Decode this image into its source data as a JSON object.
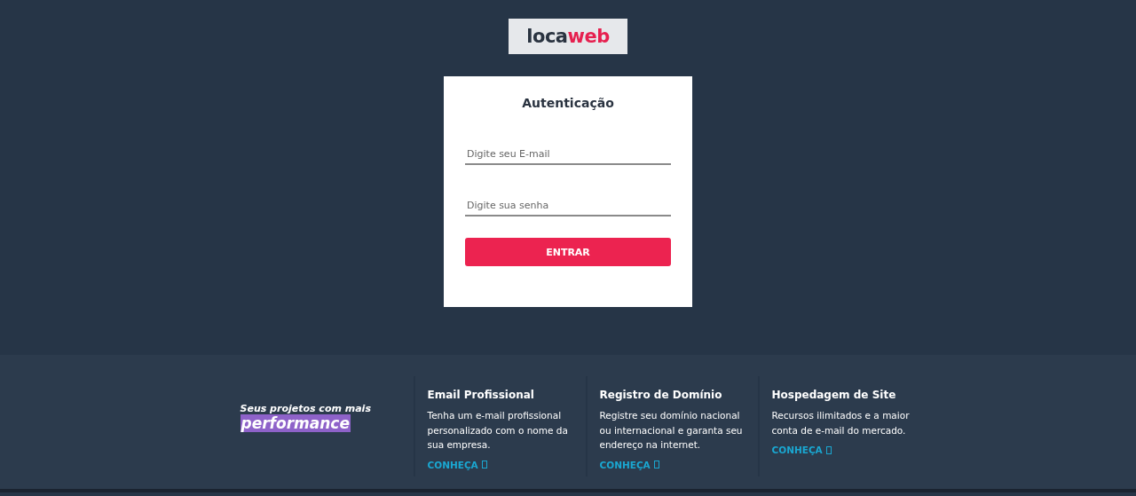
{
  "logo": {
    "text_dark": "loca",
    "text_accent": "web"
  },
  "login": {
    "title": "Autenticação",
    "email": {
      "placeholder": "Digite seu E-mail"
    },
    "password": {
      "placeholder": "Digite sua senha"
    },
    "submit": "ENTRAR"
  },
  "footer": {
    "tagline": "Seus projetos com mais",
    "highlight": "performance",
    "products": [
      {
        "title": "Email Profissional",
        "description": "Tenha um e-mail profissional personalizado com o nome da sua empresa.",
        "link": "CONHEÇA"
      },
      {
        "title": "Registro de Domínio",
        "description": "Registre seu domínio nacional ou internacional e garanta seu endereço na internet.",
        "link": "CONHEÇA"
      },
      {
        "title": "Hospedagem de Site",
        "description": "Recursos ilimitados e a maior conta de e-mail do mercado.",
        "link": "CONHEÇA"
      }
    ]
  }
}
